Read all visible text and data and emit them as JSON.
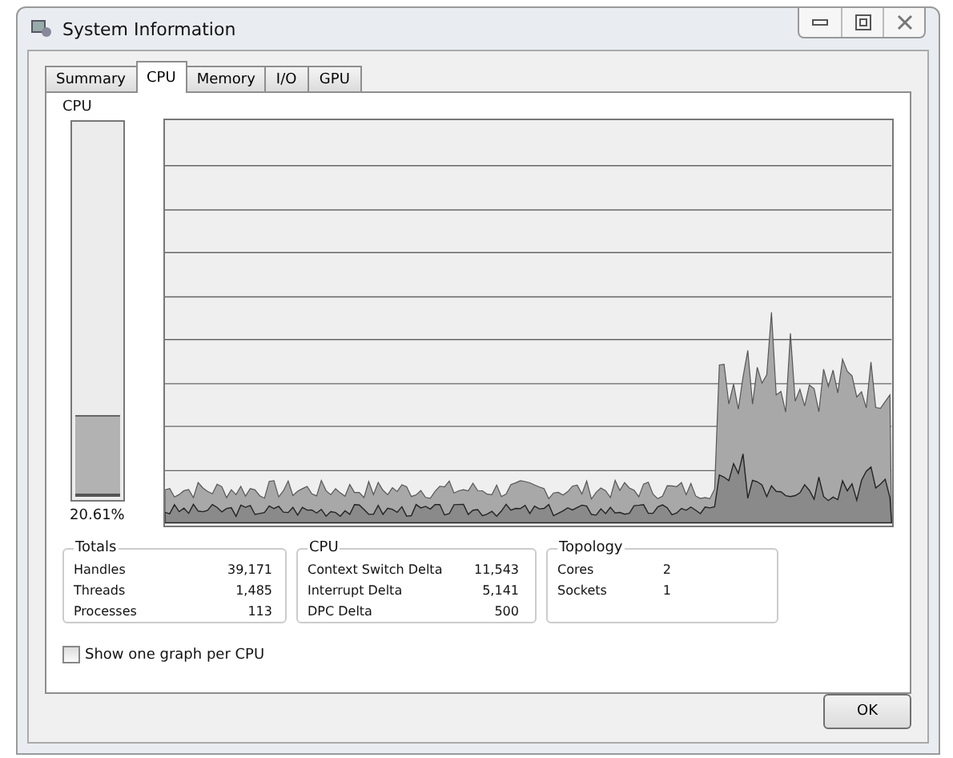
{
  "window": {
    "title": "System Information"
  },
  "tabs": [
    {
      "label": "Summary",
      "selected": false
    },
    {
      "label": "CPU",
      "selected": true
    },
    {
      "label": "Memory",
      "selected": false
    },
    {
      "label": "I/O",
      "selected": false
    },
    {
      "label": "GPU",
      "selected": false
    }
  ],
  "cpu_meter": {
    "label": "CPU",
    "level": 0.2061,
    "reading": "20.61%"
  },
  "groups": [
    {
      "title": "Totals",
      "rows": [
        {
          "label": "Handles",
          "value": "39,171"
        },
        {
          "label": "Threads",
          "value": "1,485"
        },
        {
          "label": "Processes",
          "value": "113"
        }
      ]
    },
    {
      "title": "CPU",
      "rows": [
        {
          "label": "Context Switch Delta",
          "value": "11,543"
        },
        {
          "label": "Interrupt Delta",
          "value": "5,141"
        },
        {
          "label": "DPC Delta",
          "value": "500"
        }
      ]
    },
    {
      "title": "Topology",
      "rows": [
        {
          "label": "Cores",
          "value": "2"
        },
        {
          "label": "Sockets",
          "value": "1"
        }
      ]
    }
  ],
  "per_cpu_checkbox": {
    "label": "Show one graph per CPU",
    "checked": false
  },
  "buttons": [
    "OK"
  ]
}
